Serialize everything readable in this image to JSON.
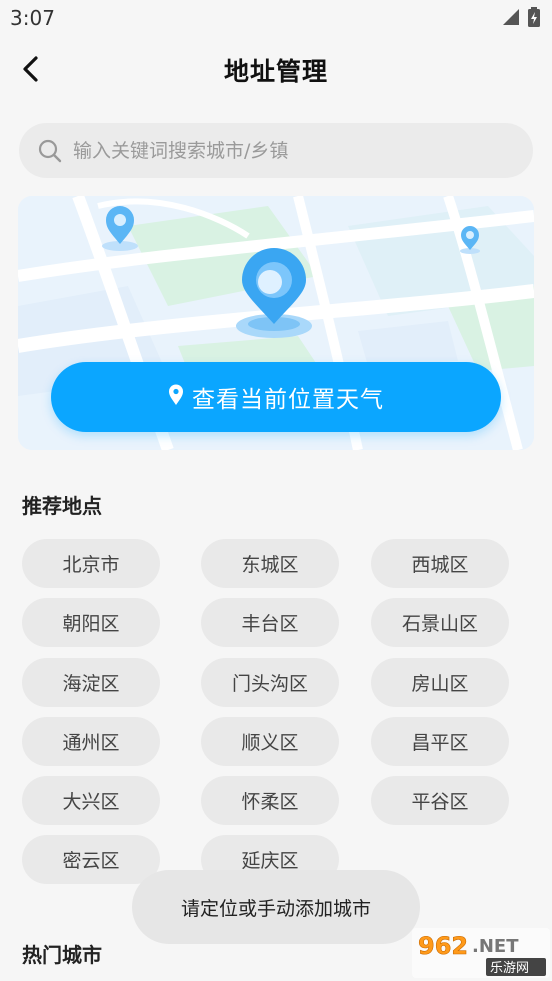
{
  "status": {
    "time": "3:07"
  },
  "header": {
    "title": "地址管理"
  },
  "search": {
    "placeholder": "输入关键词搜索城市/乡镇"
  },
  "map": {
    "locate_label": "查看当前位置天气"
  },
  "recommended": {
    "title": "推荐地点",
    "places": [
      "北京市",
      "东城区",
      "西城区",
      "朝阳区",
      "丰台区",
      "石景山区",
      "海淀区",
      "门头沟区",
      "房山区",
      "通州区",
      "顺义区",
      "昌平区",
      "大兴区",
      "怀柔区",
      "平谷区",
      "密云区",
      "延庆区"
    ]
  },
  "hot": {
    "title": "热门城市"
  },
  "toast": {
    "text": "请定位或手动添加城市"
  },
  "watermark": {
    "brand": "962.NET",
    "sub": "乐游网"
  },
  "colors": {
    "accent": "#0ba6ff",
    "chip_bg": "#e9e9e9",
    "page_bg": "#f6f6f6"
  }
}
